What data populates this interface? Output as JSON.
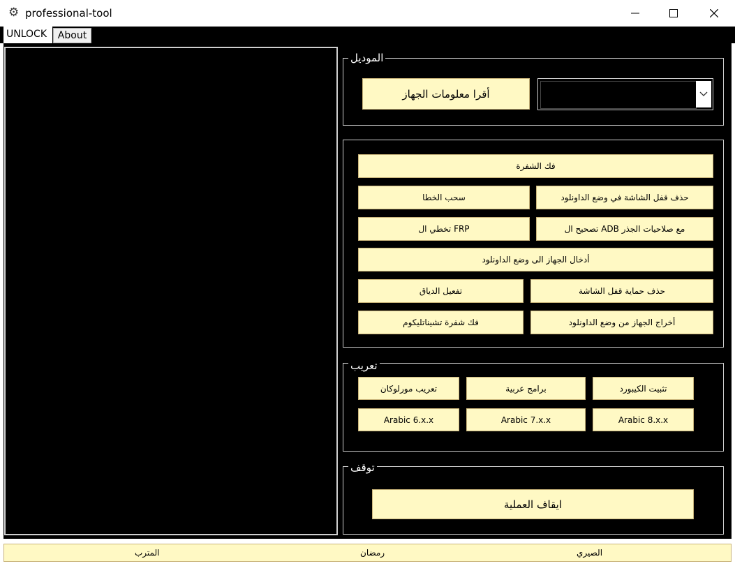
{
  "window": {
    "title": "professional-tool",
    "icon": "gear-icon"
  },
  "tabs": [
    {
      "label": "UNLOCK",
      "active": true
    },
    {
      "label": "About",
      "active": false
    }
  ],
  "groups": {
    "model": {
      "title": "الموديل",
      "read_info_label": "أقرا معلومات الجهاز",
      "model_select_value": ""
    },
    "unlock": {
      "decrypt_label": "فك الشفرة",
      "remove_lock_download_label": "حذف قفل الشاشة في وضع الداونلود",
      "pull_error_label": "سحب الخطا",
      "fix_adb_root_label": "تصحيح ال ADB مع صلاحيات الجذر",
      "bypass_frp_label": "تخطي ال FRP",
      "enter_download_label": "أدخال الجهاز الى وضع الداونلود",
      "remove_screen_protection_label": "حذف حماية قفل الشاشة",
      "enable_dyaq_label": "تفعيل الدياق",
      "exit_download_label": "أخراج الجهاز من وضع الداونلود",
      "decrypt_tecno_label": "فك شفرة تشيناتليكوم"
    },
    "arabize": {
      "title": "تعريب",
      "install_keyboard_label": "تثبيت الكيبورد",
      "arabic_apps_label": "برامج عربية",
      "arabize_moralocan_label": "تعريب مورلوكان",
      "arabic_8_label": "Arabic 8.x.x",
      "arabic_7_label": "Arabic 7.x.x",
      "arabic_6_label": "Arabic 6.x.x"
    },
    "stop": {
      "title": "توقف",
      "stop_process_label": "ايقاف العملية"
    }
  },
  "statusbar": {
    "left": "المترب",
    "center": "رمضان",
    "right": "الصيري"
  },
  "colors": {
    "button_bg": "#fff9c4",
    "panel_bg": "#000000",
    "border": "#cfcfcf"
  }
}
